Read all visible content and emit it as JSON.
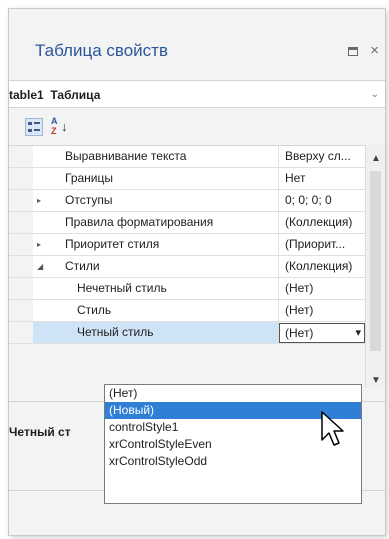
{
  "window": {
    "title": "Таблица свойств",
    "maximize_icon": "maximize-icon",
    "close_glyph": "×"
  },
  "object_selector": {
    "name": "table1",
    "type": "Таблица"
  },
  "toolbar": {
    "categorized_icon": "categorized-icon",
    "alphabetical_icon": "sort-az-icon",
    "az_top": "A",
    "az_bottom": "Z",
    "arrow": "↓"
  },
  "grid": {
    "rows": [
      {
        "name": "Выравнивание текста",
        "value": "Вверху сл...",
        "expander": "",
        "level": 1
      },
      {
        "name": "Границы",
        "value": "Нет",
        "expander": "",
        "level": 1
      },
      {
        "name": "Отступы",
        "value": "0; 0; 0; 0",
        "expander": "▸",
        "level": 1
      },
      {
        "name": "Правила форматирования",
        "value": "(Коллекция)",
        "expander": "",
        "level": 1
      },
      {
        "name": "Приоритет стиля",
        "value": "(Приорит...",
        "expander": "▸",
        "level": 1
      },
      {
        "name": "Стили",
        "value": "(Коллекция)",
        "expander": "◢",
        "level": 1
      },
      {
        "name": "Нечетный стиль",
        "value": "(Нет)",
        "expander": "",
        "level": 2
      },
      {
        "name": "Стиль",
        "value": "(Нет)",
        "expander": "",
        "level": 2
      },
      {
        "name": "Четный стиль",
        "value": "(Нет)",
        "expander": "",
        "level": 2,
        "selected": true
      }
    ]
  },
  "description": {
    "title": "Четный ст"
  },
  "dropdown": {
    "options": [
      {
        "label": "(Нет)",
        "highlighted": false
      },
      {
        "label": "(Новый)",
        "highlighted": true
      },
      {
        "label": "controlStyle1",
        "highlighted": false
      },
      {
        "label": "xrControlStyleEven",
        "highlighted": false
      },
      {
        "label": "xrControlStyleOdd",
        "highlighted": false
      }
    ]
  },
  "colors": {
    "title": "#2b579a",
    "selection": "#cfe3f7",
    "highlight": "#2f7fd6"
  }
}
